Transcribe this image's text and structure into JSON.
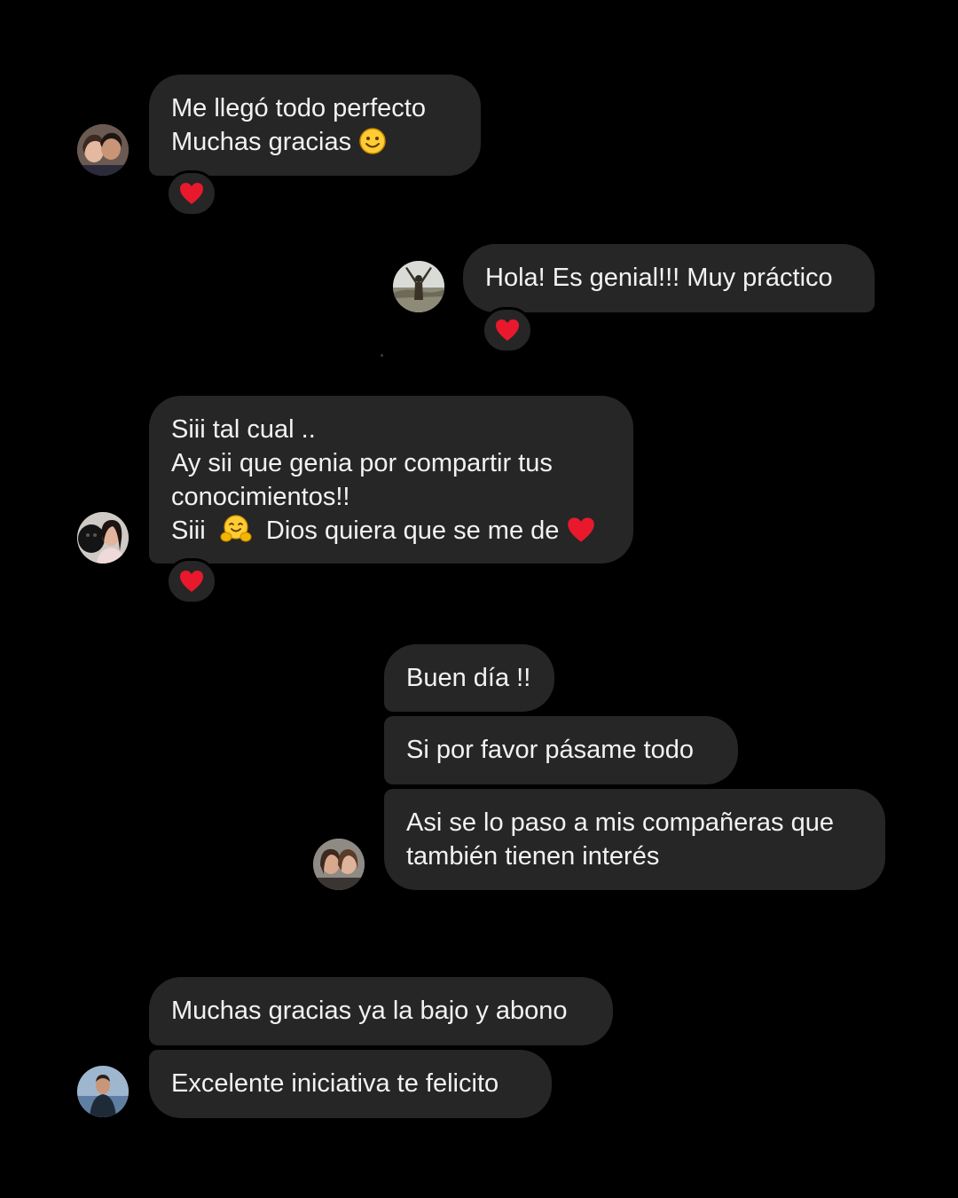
{
  "colors": {
    "background": "#000000",
    "bubble": "#262626",
    "text": "#f2f2f2",
    "heart": "#e8192c",
    "smiley": "#ffcc33"
  },
  "messages": [
    {
      "id": "m1",
      "side": "incoming",
      "lines": [
        "Me llegó todo perfecto",
        "Muchas gracias"
      ],
      "emoji_line2": "smiley-emoji",
      "reaction": "heart-icon",
      "avatar": "avatar-couple"
    },
    {
      "id": "m2",
      "side": "outgoing",
      "lines": [
        "Hola! Es genial!!! Muy práctico"
      ],
      "reaction": "heart-icon",
      "avatar": "avatar-person-arms-raised"
    },
    {
      "id": "m3",
      "side": "incoming",
      "lines": [
        "Siii tal cual ..",
        "Ay sii que genia por compartir tus",
        "conocimientos!!",
        "Siii",
        "Dios quiera que se me de"
      ],
      "emoji_line4": "hugging-emoji",
      "emoji_line4_end": "heart-emoji",
      "reaction": "heart-icon",
      "avatar": "avatar-woman-with-dog"
    },
    {
      "id": "m4",
      "side": "outgoing",
      "lines": [
        "Buen día !!"
      ]
    },
    {
      "id": "m5",
      "side": "outgoing",
      "lines": [
        "Si por favor pásame todo"
      ]
    },
    {
      "id": "m6",
      "side": "outgoing",
      "lines": [
        "Asi se lo paso a mis compañeras que",
        "también tienen interés"
      ],
      "avatar": "avatar-two-women"
    },
    {
      "id": "m7",
      "side": "incoming",
      "lines": [
        "Muchas gracias ya la bajo y abono"
      ]
    },
    {
      "id": "m8",
      "side": "incoming",
      "lines": [
        "Excelente iniciativa te felicito"
      ],
      "avatar": "avatar-man-outdoors"
    }
  ]
}
